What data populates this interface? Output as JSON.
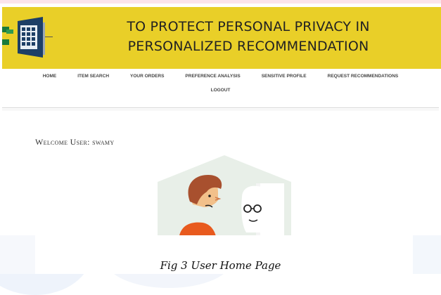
{
  "banner": {
    "title_line1": "TO PROTECT PERSONAL PRIVACY IN",
    "title_line2": "PERSONALIZED RECOMMENDATION",
    "logo_icon": "keypad-door-icon",
    "background": "#e9cf28"
  },
  "nav": {
    "items": [
      "HOME",
      "ITEM SEARCH",
      "YOUR ORDERS",
      "PREFERENCE ANALYSIS",
      "SENSITIVE PROFILE",
      "REQUEST RECOMMENDATIONS"
    ],
    "logout": "LOGOUT"
  },
  "welcome": {
    "label": "Welcome User:",
    "username": "swamy"
  },
  "illustration": {
    "icon": "people-conversation-illustration",
    "accent": "#e8efe8"
  },
  "caption": "Fig 3 User Home Page"
}
